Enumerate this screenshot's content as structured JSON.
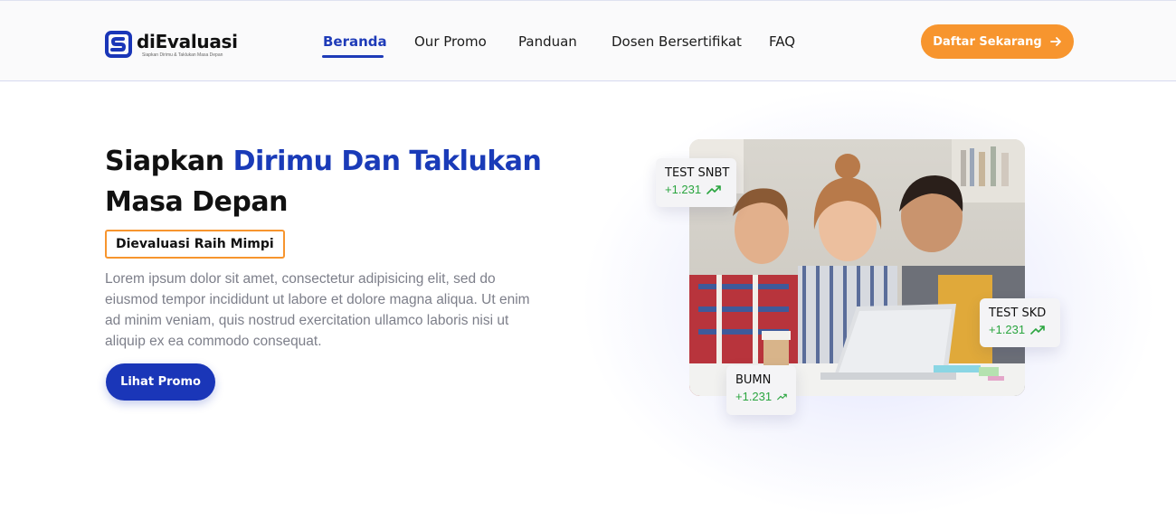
{
  "brand": {
    "name": "diEvaluasi",
    "tagline": "Siapkan Dirimu & Taklukan Masa Depan",
    "color_primary": "#1a36b8",
    "color_accent": "#f7952e"
  },
  "nav": {
    "items": [
      {
        "label": "Beranda",
        "active": true
      },
      {
        "label": "Our Promo",
        "active": false
      },
      {
        "label": "Panduan",
        "active": false
      },
      {
        "label": "Dosen Bersertifikat",
        "active": false
      },
      {
        "label": "FAQ",
        "active": false
      }
    ],
    "cta_label": "Daftar Sekarang",
    "cta_icon": "arrow-right-icon"
  },
  "hero": {
    "title_part1": "Siapkan ",
    "title_accent": "Dirimu Dan Taklukan",
    "title_part2": "Masa Depan",
    "badge": "Dievaluasi Raih Mimpi",
    "description": "Lorem ipsum dolor sit amet, consectetur adipisicing elit, sed do eiusmod tempor incididunt ut labore et dolore magna aliqua. Ut enim ad minim veniam, quis nostrud exercitation ullamco laboris nisi ut aliquip ex ea commodo consequat.",
    "button_label": "Lihat Promo"
  },
  "stats": [
    {
      "title": "TEST SNBT",
      "value": "+1.231",
      "icon": "trending-up-icon"
    },
    {
      "title": "TEST SKD",
      "value": "+1.231",
      "icon": "trending-up-icon"
    },
    {
      "title": "BUMN",
      "value": "+1.231",
      "icon": "trending-up-icon"
    }
  ],
  "colors": {
    "trend_green": "#2aa53f"
  }
}
